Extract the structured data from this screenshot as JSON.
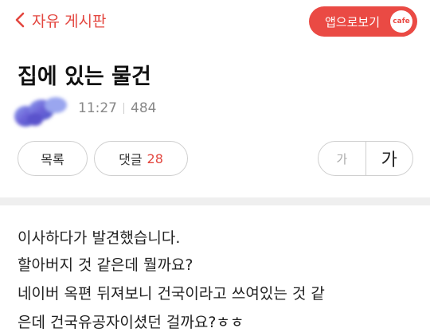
{
  "header": {
    "back_label": "자유 게시판",
    "app_button_label": "앱으로보기",
    "cafe_logo_text": "cafe",
    "accent_color": "#ea4a44"
  },
  "article": {
    "title": "집에 있는 물건",
    "time": "11:27",
    "views": "484"
  },
  "actions": {
    "list_label": "목록",
    "comment_label": "댓글",
    "comment_count": "28",
    "font_small_label": "가",
    "font_large_label": "가"
  },
  "body": {
    "lines": [
      "이사하다가 발견했습니다.",
      "할아버지 것 같은데 뭘까요?",
      "네이버 옥편 뒤져보니 건국이라고 쓰여있는 것 같",
      "은데 건국유공자이셨던 걸까요?ㅎㅎ"
    ]
  }
}
